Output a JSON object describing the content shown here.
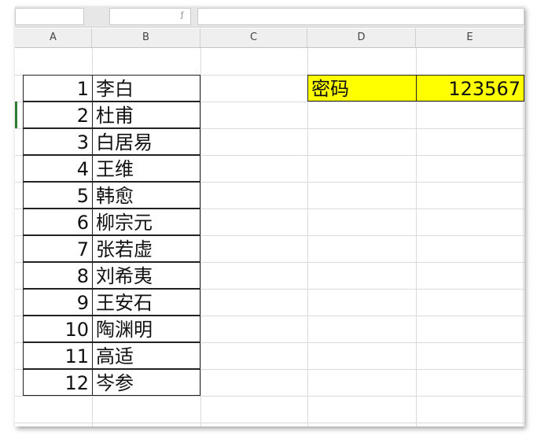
{
  "columns": [
    "A",
    "B",
    "C",
    "D",
    "E"
  ],
  "list": [
    {
      "n": "1",
      "name": "李白"
    },
    {
      "n": "2",
      "name": "杜甫"
    },
    {
      "n": "3",
      "name": "白居易"
    },
    {
      "n": "4",
      "name": "王维"
    },
    {
      "n": "5",
      "name": "韩愈"
    },
    {
      "n": "6",
      "name": "柳宗元"
    },
    {
      "n": "7",
      "name": "张若虚"
    },
    {
      "n": "8",
      "name": "刘希夷"
    },
    {
      "n": "9",
      "name": "王安石"
    },
    {
      "n": "10",
      "name": "陶渊明"
    },
    {
      "n": "11",
      "name": "高适"
    },
    {
      "n": "12",
      "name": "岑参"
    }
  ],
  "password": {
    "label": "密码",
    "value": "123567"
  },
  "colors": {
    "highlight": "#ffff00",
    "selection": "#2f7d32"
  }
}
